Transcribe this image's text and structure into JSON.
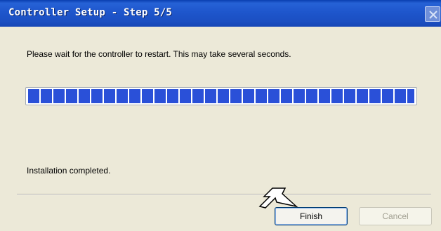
{
  "window": {
    "title": "Controller Setup - Step 5/5"
  },
  "content": {
    "message": "Please wait for the controller to restart. This may take several seconds.",
    "progress_fraction": 1.0,
    "status": "Installation completed."
  },
  "buttons": {
    "finish_label": "Finish",
    "cancel_label": "Cancel"
  },
  "icons": {
    "close": "close-icon",
    "cursor": "arrow-cursor-icon"
  },
  "colors": {
    "titlebar": "#1e56cc",
    "progress_block": "#2a50d8",
    "background": "#ece9d8"
  }
}
